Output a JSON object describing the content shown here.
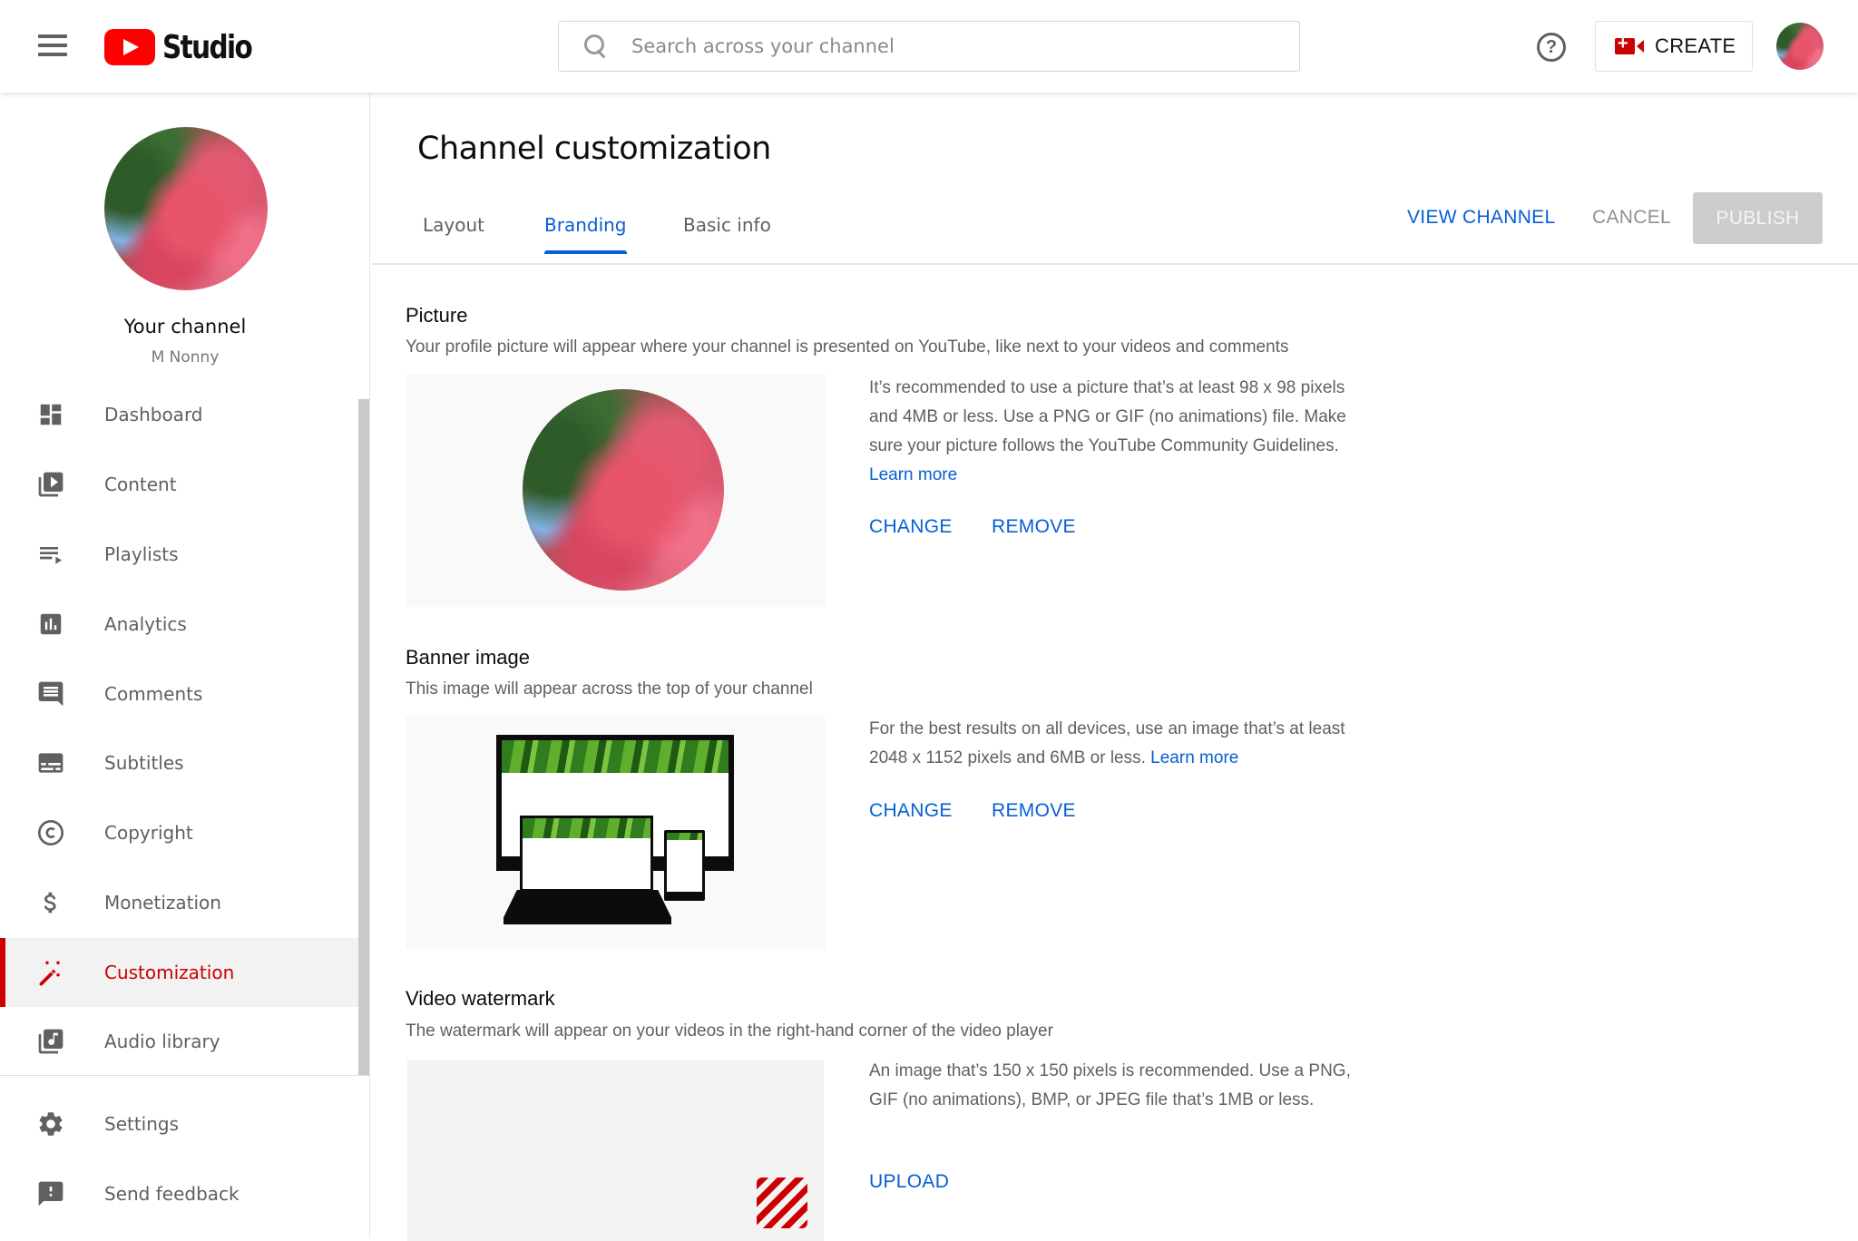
{
  "header": {
    "menu_icon": "hamburger-menu-icon",
    "logo_text": "Studio",
    "search_placeholder": "Search across your channel",
    "help_icon": "help-circle-icon",
    "help_glyph": "?",
    "create_label": "CREATE",
    "create_icon": "video-camera-plus-icon"
  },
  "sidebar": {
    "channel_title": "Your channel",
    "channel_name": "M Nonny",
    "items": [
      {
        "label": "Dashboard",
        "icon": "dashboard-icon",
        "active": false
      },
      {
        "label": "Content",
        "icon": "content-icon",
        "active": false
      },
      {
        "label": "Playlists",
        "icon": "playlists-icon",
        "active": false
      },
      {
        "label": "Analytics",
        "icon": "analytics-icon",
        "active": false
      },
      {
        "label": "Comments",
        "icon": "comments-icon",
        "active": false
      },
      {
        "label": "Subtitles",
        "icon": "subtitles-icon",
        "active": false
      },
      {
        "label": "Copyright",
        "icon": "copyright-icon",
        "active": false
      },
      {
        "label": "Monetization",
        "icon": "dollar-icon",
        "active": false
      },
      {
        "label": "Customization",
        "icon": "magic-wand-icon",
        "active": true
      },
      {
        "label": "Audio library",
        "icon": "audio-library-icon",
        "active": false
      }
    ],
    "footer_items": [
      {
        "label": "Settings",
        "icon": "gear-icon"
      },
      {
        "label": "Send feedback",
        "icon": "feedback-icon"
      }
    ]
  },
  "main": {
    "title": "Channel customization",
    "tabs": [
      {
        "label": "Layout",
        "active": false
      },
      {
        "label": "Branding",
        "active": true
      },
      {
        "label": "Basic info",
        "active": false
      }
    ],
    "actions": {
      "view_channel": "VIEW CHANNEL",
      "cancel": "CANCEL",
      "publish": "PUBLISH"
    },
    "sections": {
      "picture": {
        "title": "Picture",
        "description": "Your profile picture will appear where your channel is presented on YouTube, like next to your videos and comments",
        "info": "It’s recommended to use a picture that’s at least 98 x 98 pixels and 4MB or less. Use a PNG or GIF (no animations) file. Make sure your picture follows the YouTube Community Guidelines.",
        "learn_more": "Learn more",
        "change": "CHANGE",
        "remove": "REMOVE"
      },
      "banner": {
        "title": "Banner image",
        "description": "This image will appear across the top of your channel",
        "info": "For the best results on all devices, use an image that’s at least 2048 x 1152 pixels and 6MB or less.",
        "learn_more": "Learn more",
        "change": "CHANGE",
        "remove": "REMOVE"
      },
      "watermark": {
        "title": "Video watermark",
        "description": "The watermark will appear on your videos in the right-hand corner of the video player",
        "info": "An image that’s 150 x 150 pixels is recommended. Use a PNG, GIF (no animations), BMP, or JPEG file that’s 1MB or less.",
        "upload": "UPLOAD"
      }
    }
  },
  "colors": {
    "accent_blue": "#065fd4",
    "brand_red": "#ff0000",
    "active_red": "#cc0000",
    "disabled_gray": "#cccccc"
  }
}
